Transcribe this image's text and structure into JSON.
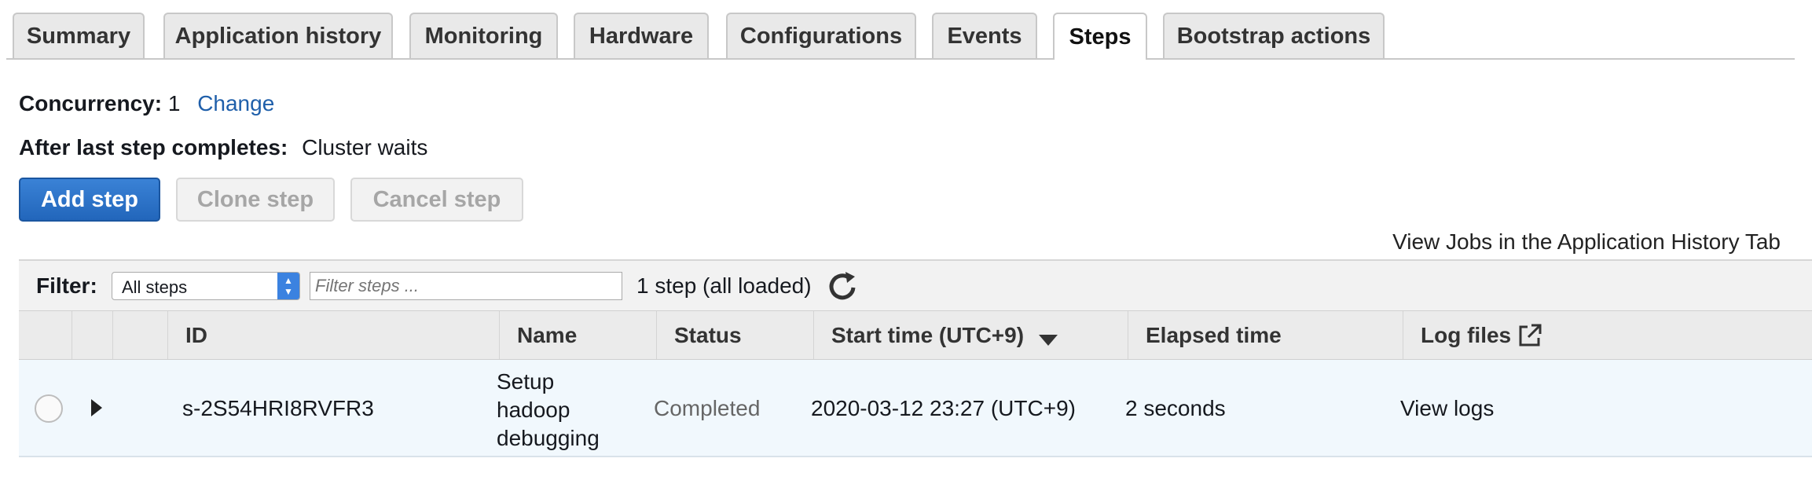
{
  "tabs": [
    {
      "label": "Summary"
    },
    {
      "label": "Application history"
    },
    {
      "label": "Monitoring"
    },
    {
      "label": "Hardware"
    },
    {
      "label": "Configurations"
    },
    {
      "label": "Events"
    },
    {
      "label": "Steps",
      "active": true
    },
    {
      "label": "Bootstrap actions"
    }
  ],
  "concurrency": {
    "label": "Concurrency:",
    "value": "1",
    "change_link": "Change"
  },
  "after_step": {
    "label": "After last step completes:",
    "value": "Cluster waits"
  },
  "buttons": {
    "add": "Add step",
    "clone": "Clone step",
    "cancel": "Cancel step"
  },
  "view_jobs_link": "View Jobs in the Application History Tab",
  "filter": {
    "label": "Filter:",
    "selected": "All steps",
    "placeholder": "Filter steps ...",
    "count": "1 step (all loaded)"
  },
  "table": {
    "headers": {
      "id": "ID",
      "name": "Name",
      "status": "Status",
      "start_time": "Start time (UTC+9)",
      "elapsed": "Elapsed time",
      "logs": "Log files"
    },
    "rows": [
      {
        "id": "s-2S54HRI8RVFR3",
        "name_lines": [
          "Setup",
          "hadoop",
          "debugging"
        ],
        "status": "Completed",
        "start_time": "2020-03-12 23:27 (UTC+9)",
        "elapsed": "2 seconds",
        "logs_link": "View logs"
      }
    ]
  },
  "colors": {
    "link": "#1f5faa",
    "primary": "#2266bb",
    "row_bg": "#f1f8fd"
  },
  "icons": {
    "refresh": "refresh-icon",
    "sort": "sort-desc-icon",
    "external": "external-link-icon",
    "expand": "expand-arrow-icon"
  }
}
